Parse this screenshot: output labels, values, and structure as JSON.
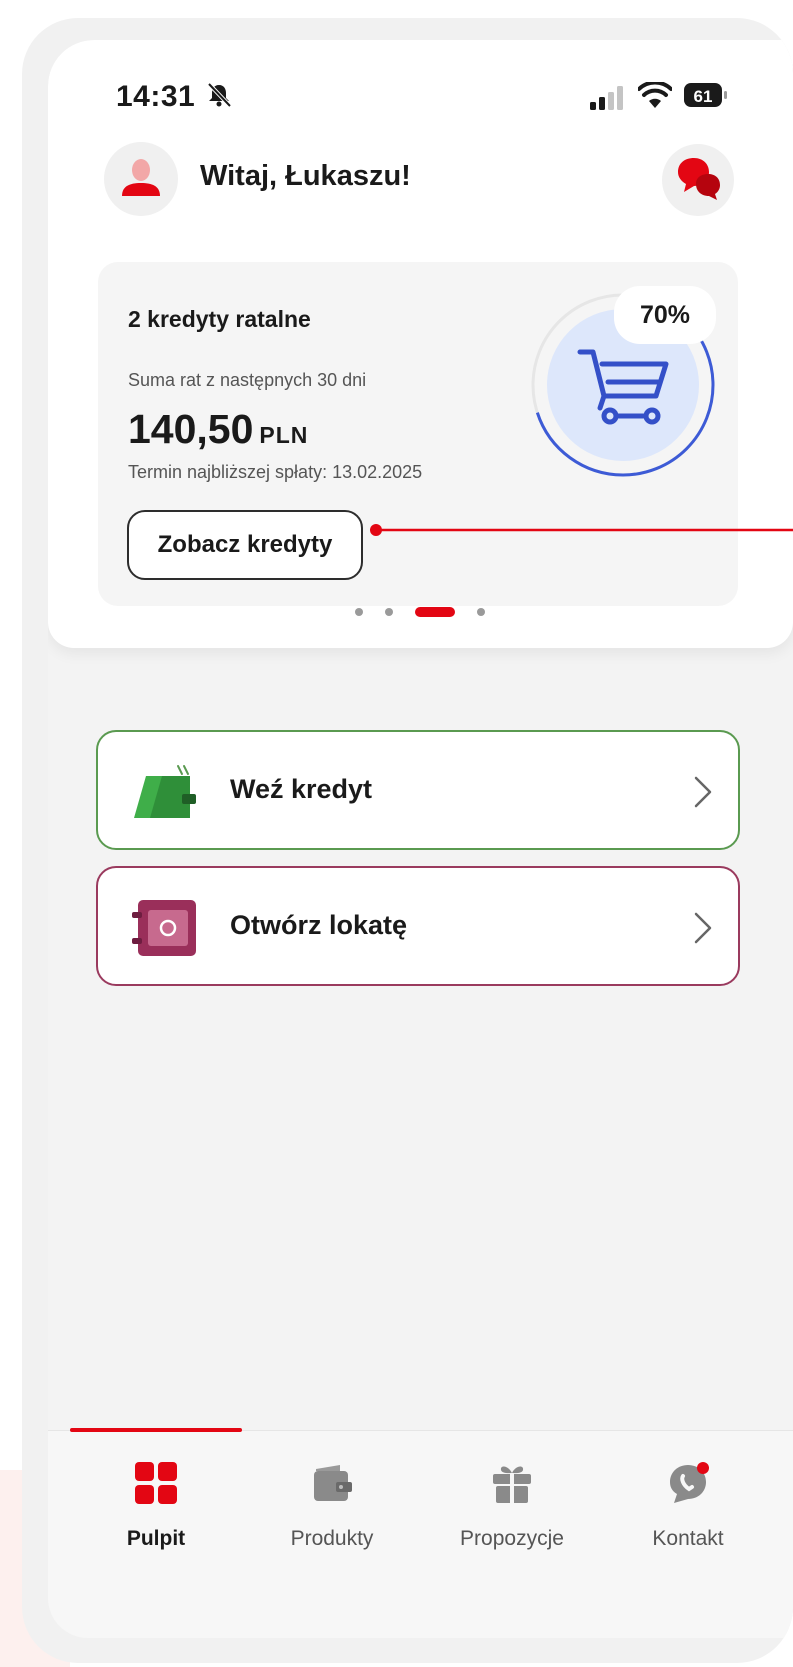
{
  "status_bar": {
    "time": "14:31",
    "battery": "61"
  },
  "header": {
    "greeting": "Witaj, Łukaszu!"
  },
  "credit_card": {
    "title": "2 kredyty ratalne",
    "subtitle": "Suma rat z następnych 30 dni",
    "amount": "140,50",
    "currency": "PLN",
    "due_date": "Termin najbliższej spłaty: 13.02.2025",
    "button_label": "Zobacz kredyty",
    "progress_label": "70%",
    "progress_value": 0.7
  },
  "carousel": {
    "count": 4,
    "active_index": 2
  },
  "menu": [
    {
      "label": "Weź kredyt",
      "icon": "wallet-icon",
      "accent": "#5a9a50"
    },
    {
      "label": "Otwórz lokatę",
      "icon": "safe-icon",
      "accent": "#9a3a5e"
    }
  ],
  "nav": [
    {
      "label": "Pulpit",
      "icon": "grid-icon",
      "active": true
    },
    {
      "label": "Produkty",
      "icon": "wallet-icon",
      "active": false
    },
    {
      "label": "Propozycje",
      "icon": "gift-icon",
      "active": false
    },
    {
      "label": "Kontakt",
      "icon": "chat-icon",
      "active": false
    }
  ],
  "colors": {
    "brand_red": "#e30613",
    "progress_blue": "#3d5bd6",
    "progress_fill": "#dde7fb"
  }
}
